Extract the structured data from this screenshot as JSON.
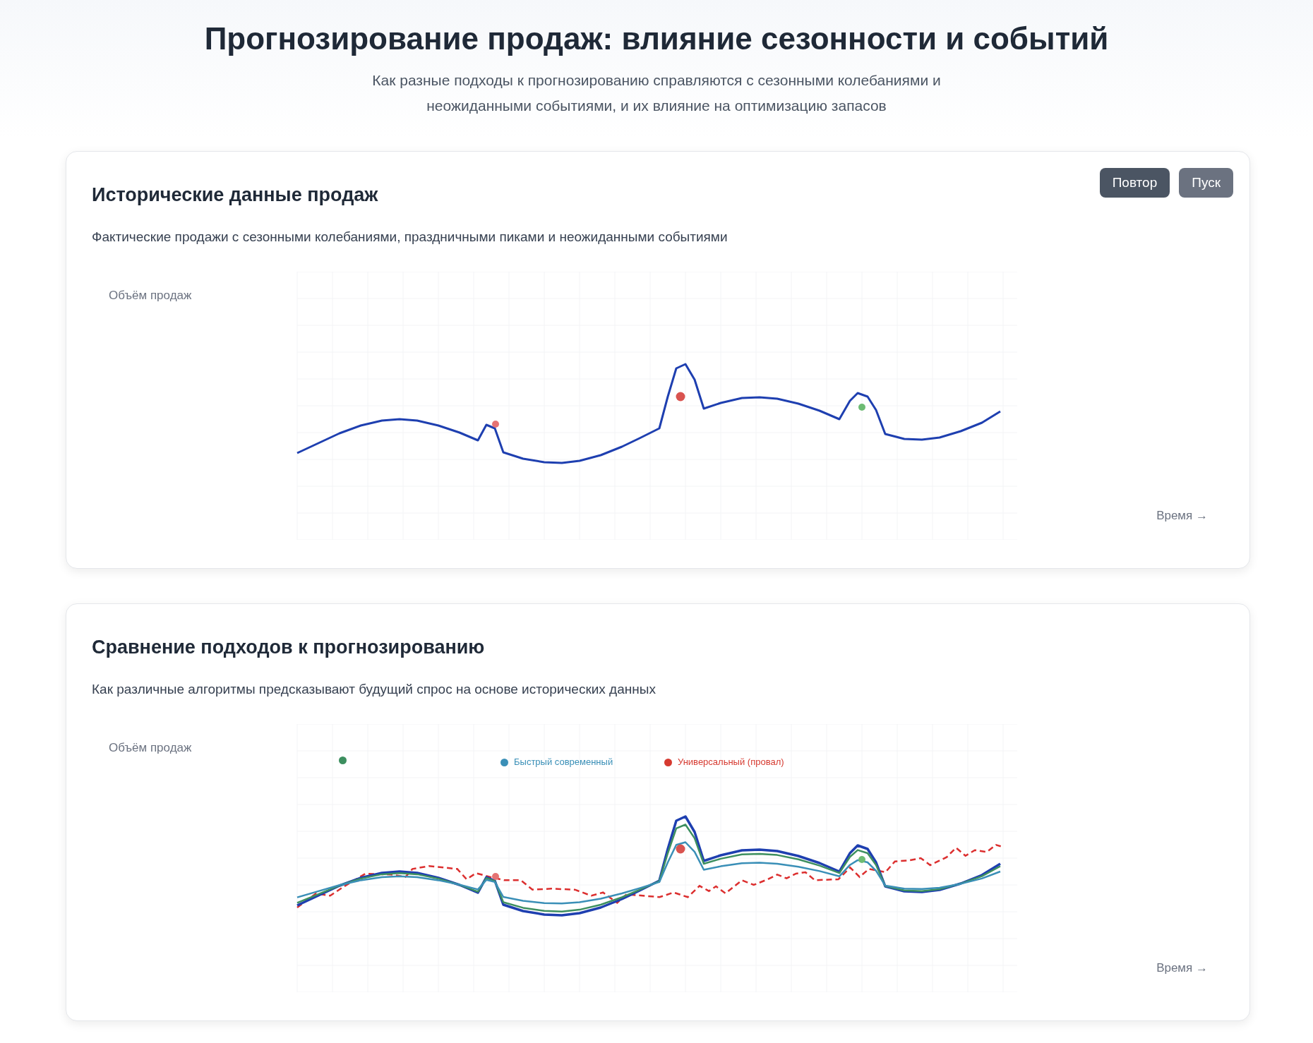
{
  "header": {
    "title": "Прогнозирование продаж: влияние сезонности и событий",
    "subtitle": "Как разные подходы к прогнозированию справляются с сезонными колебаниями и неожиданными событиями, и их влияние на оптимизацию запасов"
  },
  "sections": [
    {
      "kind": "history",
      "title": "Исторические данные продаж",
      "description": "Фактические продажи с сезонными колебаниями, праздничными пиками и неожиданными событиями",
      "y_axis_label": "Объём продаж",
      "x_axis_label": "Время →",
      "buttons": [
        {
          "label": "Повтор",
          "kind": "primary"
        },
        {
          "label": "Пуск",
          "kind": "secondary"
        }
      ]
    },
    {
      "kind": "comparison",
      "title": "Сравнение подходов к прогнозированию",
      "description": "Как различные алгоритмы предсказывают будущий спрос на основе исторических данных",
      "y_axis_label": "Объём продаж",
      "x_axis_label": "Время →",
      "legend": [
        {
          "color": "#3d8f5f"
        },
        {
          "label": "Быстрый современный",
          "color": "#3a8fb7"
        },
        {
          "label": "Универсальный (провал)",
          "color": "#d63a30"
        }
      ]
    }
  ]
}
